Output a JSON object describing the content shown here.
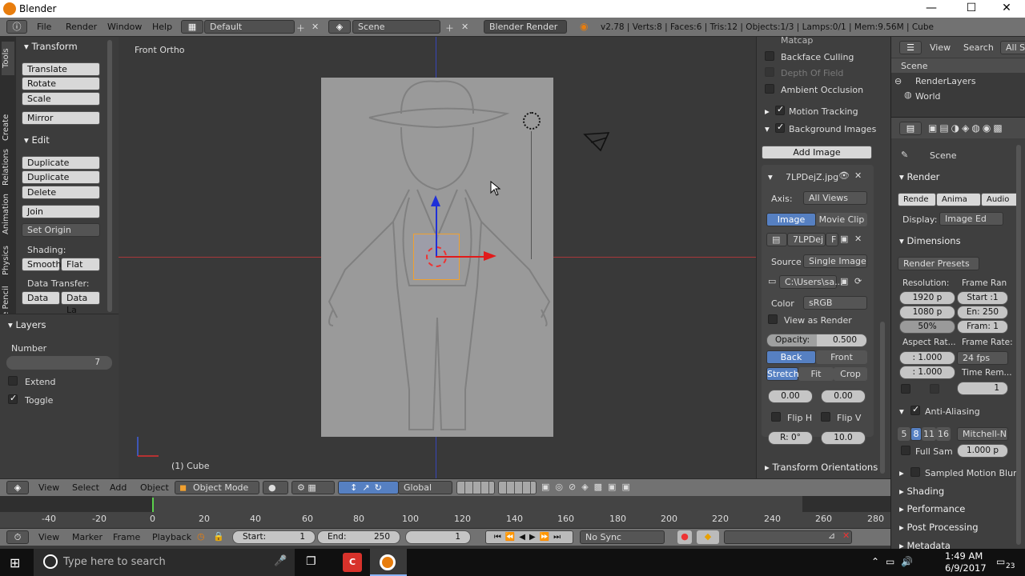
{
  "window": {
    "title": "Blender",
    "min": "—",
    "max": "☐",
    "close": "✕"
  },
  "infobar": {
    "menus": [
      "File",
      "Render",
      "Window",
      "Help"
    ],
    "screen": "Default",
    "scene": "Scene",
    "engine": "Blender Render",
    "stats": "v2.78 | Verts:8 | Faces:6 | Tris:12 | Objects:1/3 | Lamps:0/1 | Mem:9.56M | Cube"
  },
  "toolshelf": {
    "tabs": [
      "Tools",
      "Create",
      "Relations",
      "Animation",
      "Physics",
      "Grease Pencil"
    ],
    "transform_header": "Transform",
    "translate": "Translate",
    "rotate": "Rotate",
    "scale": "Scale",
    "mirror": "Mirror",
    "edit_header": "Edit",
    "duplicate": "Duplicate",
    "duplicate_linked": "Duplicate Linked",
    "delete": "Delete",
    "join": "Join",
    "set_origin": "Set Origin",
    "shading_label": "Shading:",
    "smooth": "Smooth",
    "flat": "Flat",
    "data_transfer_label": "Data Transfer:",
    "data": "Data",
    "data_la": "Data La",
    "layers_header": "Layers",
    "number_label": "Number",
    "number_value": "7",
    "extend": "Extend",
    "toggle": "Toggle"
  },
  "viewport": {
    "view_name": "Front Ortho",
    "object_name": "(1) Cube"
  },
  "nprops": {
    "matcap": "Matcap",
    "backface": "Backface Culling",
    "dof": "Depth Of Field",
    "ao": "Ambient Occlusion",
    "motion_tracking": "Motion Tracking",
    "background_images": "Background Images",
    "add_image": "Add Image",
    "image_name": "7LPDejZ.jpg",
    "axis_label": "Axis:",
    "axis_value": "All Views",
    "image_tab": "Image",
    "movieclip_tab": "Movie Clip",
    "img_field": "7LPDej",
    "f_btn": "F",
    "source_label": "Source",
    "source_value": "Single Image",
    "path": "C:\\Users\\sa...",
    "color_label": "Color",
    "color_value": "sRGB",
    "view_as_render": "View as Render",
    "opacity_label": "Opacity:",
    "opacity_value": "0.500",
    "back": "Back",
    "front": "Front",
    "stretch": "Stretch",
    "fit": "Fit",
    "crop": "Crop",
    "offx": "0.00",
    "offy": "0.00",
    "flip_h": "Flip H",
    "flip_v": "Flip V",
    "rot": "R: 0°",
    "size": "10.0",
    "transform_orientations": "Transform Orientations"
  },
  "outliner": {
    "view": "View",
    "search": "Search",
    "all_scenes": "All Sc",
    "items": [
      "Scene",
      "RenderLayers",
      "World"
    ]
  },
  "properties": {
    "context": "Scene",
    "render_header": "Render",
    "render_btn": "Rende",
    "anim_btn": "Anima",
    "audio_btn": "Audio",
    "display_label": "Display:",
    "display_value": "Image Ed",
    "dimensions_header": "Dimensions",
    "render_presets": "Render Presets",
    "resolution_label": "Resolution:",
    "frame_range_label": "Frame Ran",
    "res_x": "1920 p",
    "res_y": "1080 p",
    "res_pct": "50%",
    "start": "Start :1",
    "end": "En: 250",
    "frame": "Fram: 1",
    "aspect_label": "Aspect Rat...",
    "framerate_label": "Frame Rate:",
    "asp_x": ": 1.000",
    "asp_y": ": 1.000",
    "fps": "24 fps",
    "time_remap": "Time Rem...",
    "tr_val": "1",
    "aa_header": "Anti-Aliasing",
    "aa_samples": [
      "5",
      "8",
      "11",
      "16"
    ],
    "aa_filter": "Mitchell-N",
    "full_sample": "Full Sam",
    "filter_size": "1.000 p",
    "sampled_motion_blur": "Sampled Motion Blur",
    "shading": "Shading",
    "performance": "Performance",
    "post_processing": "Post Processing",
    "metadata": "Metadata"
  },
  "view3d_header": {
    "view": "View",
    "select": "Select",
    "add": "Add",
    "object": "Object",
    "mode": "Object Mode",
    "orientation": "Global"
  },
  "timeline": {
    "ticks": [
      "-40",
      "-20",
      "0",
      "20",
      "40",
      "60",
      "80",
      "100",
      "120",
      "140",
      "160",
      "180",
      "200",
      "220",
      "240",
      "260",
      "280"
    ],
    "view": "View",
    "marker": "Marker",
    "frame": "Frame",
    "playback": "Playback",
    "start": "Start:",
    "start_val": "1",
    "end": "End:",
    "end_val": "250",
    "current": "1",
    "sync": "No Sync"
  },
  "taskbar": {
    "search_placeholder": "Type here to search",
    "time": "1:49 AM",
    "date": "6/9/2017",
    "notif": "23"
  }
}
